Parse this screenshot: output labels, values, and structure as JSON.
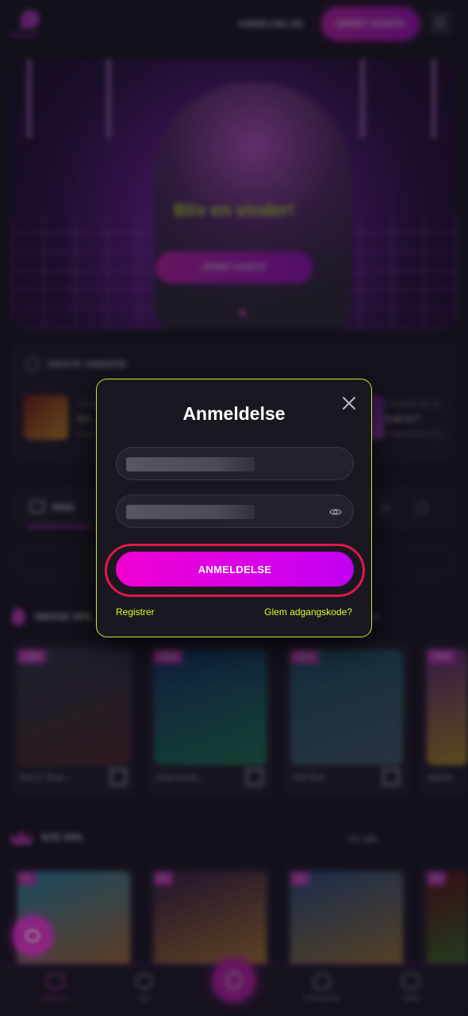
{
  "header": {
    "logo_text": "BRAND",
    "login_label": "ANMELDELSE",
    "signup_label": "OPRET KONTO"
  },
  "hero": {
    "headline": "Bliv en vinder!",
    "cta_label": "OPRET KONTO"
  },
  "winners": {
    "title": "SIDSTE VINDERE",
    "items": [
      {
        "name": "Christ…",
        "amount": "6,6…",
        "game": "Diam…"
      },
      {
        "name": "Christian har fg…",
        "amount": "6,42 kr.7",
        "game": "Goldsmash 100…"
      }
    ]
  },
  "tabs": {
    "home_label": "Hele",
    "other_label": "pil"
  },
  "sections": {
    "hot_title": "HEISSE SPIL",
    "new_title": "NYE SPIL",
    "see_all": "Vis alle"
  },
  "hot_games": [
    {
      "title": "Riot 2: Brav…",
      "tag": "VARM",
      "color_a": "#2a3c4e",
      "color_b": "#5a2a2a"
    },
    {
      "title": "Julemande…",
      "tag": "VARM",
      "color_a": "#0e3a7a",
      "color_b": "#1a8a5a"
    },
    {
      "title": "Vild Ånd",
      "tag": "VARM",
      "color_a": "#1a5a6e",
      "color_b": "#4a6a7a"
    },
    {
      "title": "Myste…",
      "tag": "VARM",
      "color_a": "#6a2a8a",
      "color_b": "#c8a020"
    }
  ],
  "new_games": [
    {
      "tag": "NY",
      "color_a": "#2aa0c8",
      "color_b": "#e07a2a"
    },
    {
      "tag": "NY",
      "color_a": "#3a1a4a",
      "color_b": "#e0a030"
    },
    {
      "tag": "NY",
      "color_a": "#2a5a9a",
      "color_b": "#c8902a"
    },
    {
      "tag": "NY",
      "color_a": "#6a1010",
      "color_b": "#3a8a2a"
    }
  ],
  "bottom_nav": [
    {
      "label": "Hjemme",
      "icon": "home-icon"
    },
    {
      "label": "Spil",
      "icon": "games-icon"
    },
    {
      "label": "Kampagner",
      "icon": "promotions-icon"
    },
    {
      "label": "Søtte",
      "icon": "chat-icon"
    }
  ],
  "modal": {
    "title": "Anmeldelse",
    "username_value": "",
    "password_value": "",
    "submit_label": "ANMELDELSE",
    "register_link": "Registrer",
    "forgot_link": "Glem adgangskode?"
  },
  "colors": {
    "accent": "#e020c8",
    "highlight": "#d4ff2a",
    "modal_border": "#c8e830",
    "focus_ring": "#e0184c"
  }
}
